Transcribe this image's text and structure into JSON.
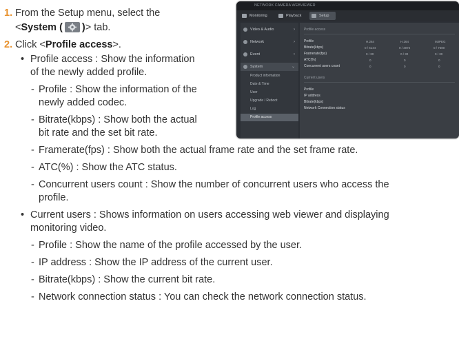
{
  "steps": [
    {
      "number": "1.",
      "text_before": "From the Setup menu, select the",
      "line2_before": "<",
      "line2_bold": "System (",
      "line2_after_icon": ")",
      "line2_end": "> tab."
    },
    {
      "number": "2.",
      "text_before": "Click <",
      "bold": "Profile access",
      "text_after": ">."
    }
  ],
  "profile_access": {
    "bullet": "•",
    "line1": "Profile access : Show the information",
    "line2": "of the newly added profile.",
    "items": [
      {
        "dash": "-",
        "line1": "Profile : Show the information of the",
        "line2": "newly added codec."
      },
      {
        "dash": "-",
        "line1": "Bitrate(kbps) : Show both the actual",
        "line2": "bit rate and the set bit rate."
      },
      {
        "dash": "-",
        "line1": "Framerate(fps) : Show both the actual frame rate and the set frame rate."
      },
      {
        "dash": "-",
        "line1": "ATC(%) : Show the ATC status."
      },
      {
        "dash": "-",
        "line1": "Concurrent users count : Show the number of concurrent users who access the",
        "line2": "profile."
      }
    ]
  },
  "current_users": {
    "bullet": "•",
    "line1": "Current users : Shows information on users accessing web viewer and displaying",
    "line2": "monitoring video.",
    "items": [
      {
        "dash": "-",
        "line1": "Profile : Show the name of the profile accessed by the user."
      },
      {
        "dash": "-",
        "line1": "IP address : Show the IP address of the current user."
      },
      {
        "dash": "-",
        "line1": "Bitrate(kbps) : Show the current bit rate."
      },
      {
        "dash": "-",
        "line1": "Network connection status : You can check the network connection status."
      }
    ]
  },
  "screenshot": {
    "title": "NETWORK CAMERA WEBVIEWER",
    "tabs": [
      "Monitoring",
      "Playback",
      "Setup"
    ],
    "sidebar": [
      "Video & Audio",
      "Network",
      "Event",
      "System"
    ],
    "submenu": [
      "Product information",
      "Date & Time",
      "User",
      "Upgrade / Reboot",
      "Log",
      "Profile access"
    ],
    "section1": "Profile access",
    "rows1": [
      "Profile",
      "Bitrate(kbps)",
      "Framerate(fps)",
      "ATC(%)",
      "Concurrent users count"
    ],
    "section2": "Current users",
    "rows2": [
      "Profile",
      "IP address",
      "Bitrate(kbps)",
      "Network Connection status"
    ],
    "col_headers": [
      "H.264",
      "H.264",
      "MJPEG"
    ],
    "col_values": [
      [
        "0 / 6144",
        "0 / 3072",
        "0 / 7680"
      ],
      [
        "0 / 30",
        "0 / 30",
        "0 / 30"
      ],
      [
        "0",
        "0",
        "0"
      ],
      [
        "0",
        "0",
        "0"
      ]
    ]
  },
  "colors": {
    "step_number": "#e8912c",
    "body_text": "#333333"
  }
}
